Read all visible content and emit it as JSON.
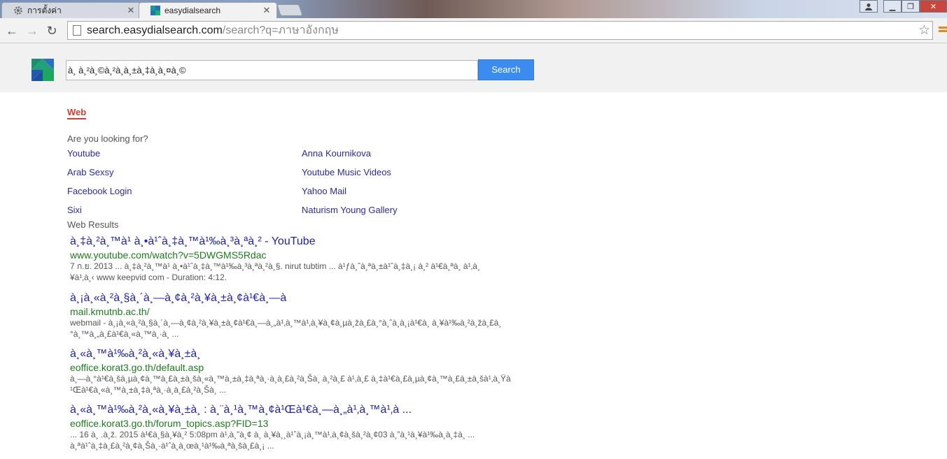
{
  "tabs": [
    {
      "title": "การตั้งค่า",
      "icon": "gear-icon"
    },
    {
      "title": "easydialsearch",
      "icon": "site-favicon"
    }
  ],
  "address": {
    "host": "search.easydialsearch.com",
    "path": "/search?q=ภาษาอังกฤษ"
  },
  "search": {
    "query": "à¸ à¸²à¸©à¸²à¸­à¸±à¸‡à¸à¸¤à¸©",
    "button_label": "Search"
  },
  "web_tab_label": "Web",
  "suggestions": {
    "heading": "Are you looking for?",
    "left": [
      "Youtube",
      "Arab Sexsy",
      "Facebook Login",
      "Sixi"
    ],
    "right": [
      "Anna Kournikova",
      "Youtube Music Videos",
      "Yahoo Mail",
      "Naturism Young Gallery"
    ]
  },
  "results_heading": "Web Results",
  "results": [
    {
      "title": "à¸‡à¸²à¸™à¹ à¸•à¹ˆà¸‡à¸™à¹‰à¸³à¸ªà¸² - YouTube",
      "url": "www.youtube.com/watch?v=5DWGMS5Rdac",
      "snippet1": "7 ก.ย. 2013 ... à¸‡à¸²à¸™à¹ à¸•à¹ˆà¸‡à¸™à¹‰à¸³à¸ªà¸²à¸§. nirut tubtim ... à¹ƒà¸ˆà¸ªà¸±à¹ˆà¸‡à¸¡ à¸² à¹€à¸ªà¸ à¹‚à¸",
      "snippet2": "¥à¹‚à¸‹ www keepvid com - Duration: 4:12."
    },
    {
      "title": "à¸¡à¸«à¸²à¸§à¸´à¸—à¸¢à¸²à¸¥à¸±à¸¢à¹€à¸—à",
      "url": "mail.kmutnb.ac.th/",
      "snippet1": "webmail - à¸¡à¸«à¸²à¸§à¸´à¸—à¸¢à¸²à¸¥à¸±à¸¢à¹€à¸—à¸„à¹‚à¸™à¹‚à¸¥à¸¢à¸µà¸žà¸£à¸°à¸ˆà¸­à¸¡à¹€à¸ à¸¥à¹‰à¸²à¸žà¸£à¸",
      "snippet2": "°à¸™à¸„à¸£à¹€à¸«à¸™à¸·à¸ ..."
    },
    {
      "title": "à¸«à¸™à¹‰à¸²à¸«à¸¥à¸±à¸",
      "url": "eoffice.korat3.go.th/default.asp",
      "snippet1": "à¸—à¸°à¹€à¸šà¸µà¸¢à¸™à¸£à¸±à¸šà¸«à¸™à¸±à¸‡à¸ªà¸·à¸­à¸£à¸²à¸Šà¸ à¸²à¸£ à¹‚à¸£ à¸‡à¹€à¸£à¸µà¸¢à¸™à¸£à¸±à¸šà¹‚à¸Ÿà",
      "snippet2": "¹Œà¹€à¸«à¸™à¸±à¸‡à¸ªà¸·à¸­à¸£à¸²à¸Šà¸ ..."
    },
    {
      "title": "à¸«à¸™à¹‰à¸²à¸«à¸¥à¸±à¸ : à¸¨à¸¹à¸™à¸¢à¹Œà¹€à¸—à¸„à¹‚à¸™à¹‚à ...",
      "url": "eoffice.korat3.go.th/forum_topics.asp?FID=13",
      "snippet1": "... 16 à¸ .à¸ž. 2015 à¹€à¸§à¸¥à¸² 5:08pm à¹‚à¸”à¸¢ à¸ à¸¥à¸¸à¹ˆà¸¡à¸™à¹‚à¸¢à¸šà¸²à¸¢03 à¸”à¸¹à¸¥à¹‰à¸­à¸‡à¸ ...",
      "snippet2": "à¸ªà¹ˆà¸‡à¸£à¸²à¸¢à¸Šà¸·à¹ˆà¸­à¸œà¸¹à¹‰à¸ªà¸šà¸£à¸¡ ..."
    }
  ]
}
